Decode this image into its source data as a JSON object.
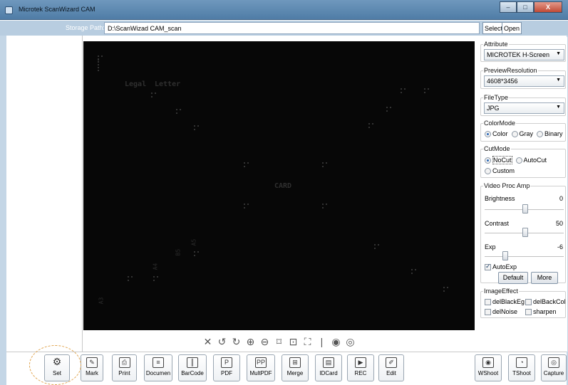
{
  "window": {
    "title": "Microtek ScanWizard CAM",
    "buttons": [
      "–",
      "□",
      "X"
    ]
  },
  "path_bar": {
    "label": "Storage Path:",
    "value": "D:\\ScanWizad CAM_scan",
    "select": "Select",
    "open": "Open"
  },
  "preview": {
    "labels": {
      "legal": "Legal",
      "letter": "Letter",
      "card": "CARD",
      "a5": "A5",
      "b5": "B5",
      "a4": "A4",
      "a3": "A3"
    }
  },
  "preview_toolbar": [
    "✕",
    "↺",
    "↻",
    "⊕",
    "⊖",
    "⌑",
    "⊡",
    "⛶",
    "|",
    "◉",
    "◎"
  ],
  "panel": {
    "attribute": {
      "title": "Attribute",
      "value": "MICROTEK H-Screen"
    },
    "preview_resolution": {
      "title": "PreviewResolution",
      "value": "4608*3456"
    },
    "file_type": {
      "title": "FileType",
      "value": "JPG"
    },
    "color_mode": {
      "title": "ColorMode",
      "options": [
        "Color",
        "Gray",
        "Binary"
      ],
      "selected": "Color"
    },
    "cut_mode": {
      "title": "CutMode",
      "options": [
        "NoCut",
        "AutoCut",
        "Custom"
      ],
      "selected": "NoCut"
    },
    "video_proc_amp": {
      "title": "Video Proc Amp",
      "brightness": {
        "label": "Brightness",
        "value": "0"
      },
      "contrast": {
        "label": "Contrast",
        "value": "50"
      },
      "exp": {
        "label": "Exp",
        "value": "-6"
      },
      "autoexp": {
        "label": "AutoExp",
        "checked": true
      },
      "default_label": "Default",
      "more_label": "More"
    },
    "image_effect": {
      "title": "ImageEffect",
      "options": [
        "delBlackEg",
        "delBackCol",
        "delNoise",
        "sharpen"
      ]
    }
  },
  "toolbar": {
    "set": "Set",
    "mark": "Mark",
    "print": "Print",
    "document": "Documen",
    "barcode": "BarCode",
    "pdf": "PDF",
    "multpdf": "MultPDF",
    "merge": "Merge",
    "idcard": "IDCard",
    "rec": "REC",
    "edit": "Edit",
    "wshoot": "WShoot",
    "tshoot": "TShoot",
    "capture": "Capture"
  }
}
